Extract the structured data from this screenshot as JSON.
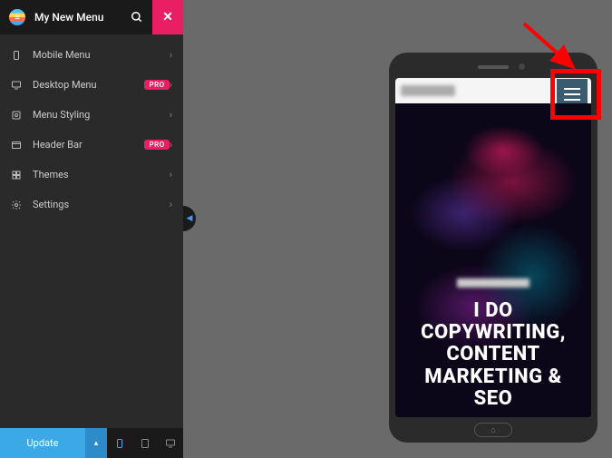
{
  "header": {
    "title": "My New Menu",
    "close_label": "✕"
  },
  "menu": {
    "items": [
      {
        "label": "Mobile Menu",
        "pro": false,
        "icon": "mobile"
      },
      {
        "label": "Desktop Menu",
        "pro": true,
        "icon": "desktop"
      },
      {
        "label": "Menu Styling",
        "pro": false,
        "icon": "styling"
      },
      {
        "label": "Header Bar",
        "pro": true,
        "icon": "header"
      },
      {
        "label": "Themes",
        "pro": false,
        "icon": "themes"
      },
      {
        "label": "Settings",
        "pro": false,
        "icon": "settings"
      }
    ],
    "pro_badge": "PRO"
  },
  "footer": {
    "update_label": "Update",
    "toggle_glyph": "▴"
  },
  "collapse_glyph": "◀",
  "phone": {
    "home_glyph": "⌂",
    "hero_lines": [
      "I DO",
      "COPYWRITING,",
      "CONTENT",
      "MARKETING &",
      "SEO"
    ]
  }
}
